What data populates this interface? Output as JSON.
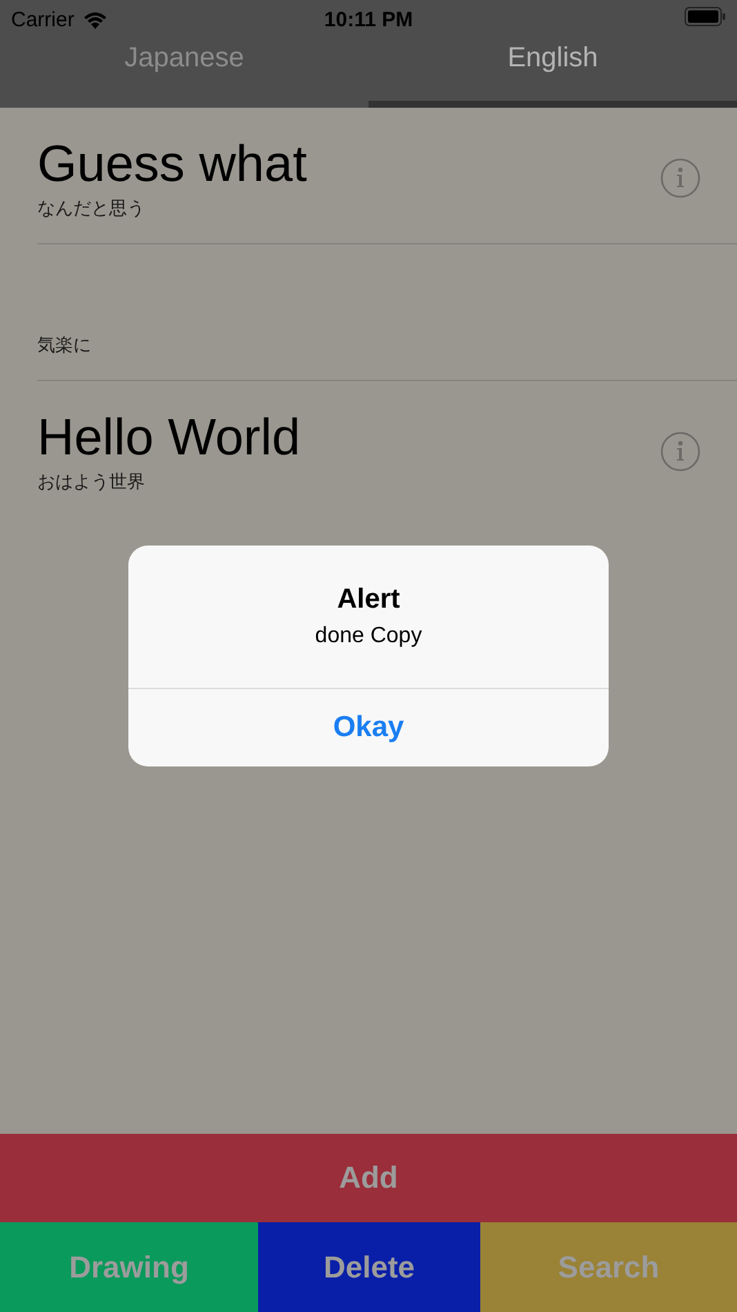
{
  "status_bar": {
    "carrier": "Carrier",
    "time": "10:11 PM"
  },
  "tabs": [
    {
      "label": "Japanese",
      "selected": false
    },
    {
      "label": "English",
      "selected": true
    }
  ],
  "rows": [
    {
      "title": "Guess what",
      "subtitle": "なんだと思う",
      "info": true
    },
    {
      "subtitle": "気楽に",
      "info": false
    },
    {
      "title": "Hello World",
      "subtitle": "おはよう世界",
      "info": true
    }
  ],
  "alert": {
    "title": "Alert",
    "message": "done Copy",
    "button": "Okay"
  },
  "add_button": {
    "label": "Add",
    "color": "#9a2e3a"
  },
  "bottom_buttons": [
    {
      "label": "Drawing",
      "color": "#0a9a5c"
    },
    {
      "label": "Delete",
      "color": "#0a1fa8"
    },
    {
      "label": "Search",
      "color": "#9a8236"
    }
  ]
}
